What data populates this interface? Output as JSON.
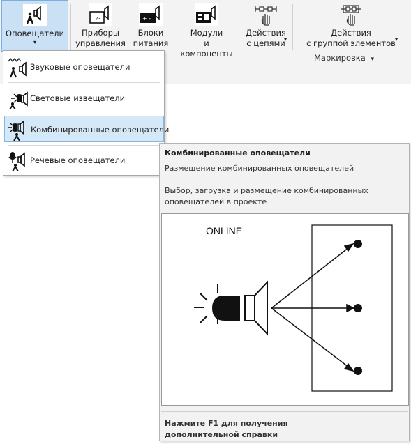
{
  "ribbon": {
    "buttons": [
      {
        "label": "Оповещатели",
        "caret": "▾",
        "icon": "horn-person-icon"
      },
      {
        "label": "Приборы\nуправления",
        "icon": "control-panel-icon"
      },
      {
        "label": "Блоки\nпитания",
        "icon": "power-supply-icon"
      },
      {
        "label": "Модули\nи компоненты",
        "icon": "module-icon"
      },
      {
        "label": "Действия\nс цепями",
        "caret": "▾",
        "icon": "circuit-hand-icon"
      },
      {
        "label": "Действия\nс группой элементов",
        "caret": "▾",
        "icon": "group-hand-icon"
      }
    ],
    "group_label": "Маркировка",
    "group_caret": "▾"
  },
  "menu": {
    "items": [
      {
        "label": "Звуковые оповещатели",
        "icon": "sound-alarm-icon"
      },
      {
        "label": "Световые извещатели",
        "icon": "light-alarm-icon"
      },
      {
        "label": "Комбинированные оповещатели",
        "icon": "combined-alarm-icon",
        "highlighted": true
      },
      {
        "label": "Речевые оповещатели",
        "icon": "voice-alarm-icon"
      }
    ]
  },
  "tooltip": {
    "title": "Комбинированные оповещатели",
    "subtitle": "Размещение комбинированных оповещателей",
    "description": "Выбор, загрузка и размещение комбинированных оповещателей в проекте",
    "image_caption": "ONLINE",
    "help": "Нажмите F1 для получения дополнительной справки"
  },
  "colors": {
    "ribbon_bg": "#f3f3f3",
    "active_bg": "#c9e0f5",
    "highlight_bg": "#d5e8f7",
    "tooltip_bg": "#f2f2f2"
  }
}
